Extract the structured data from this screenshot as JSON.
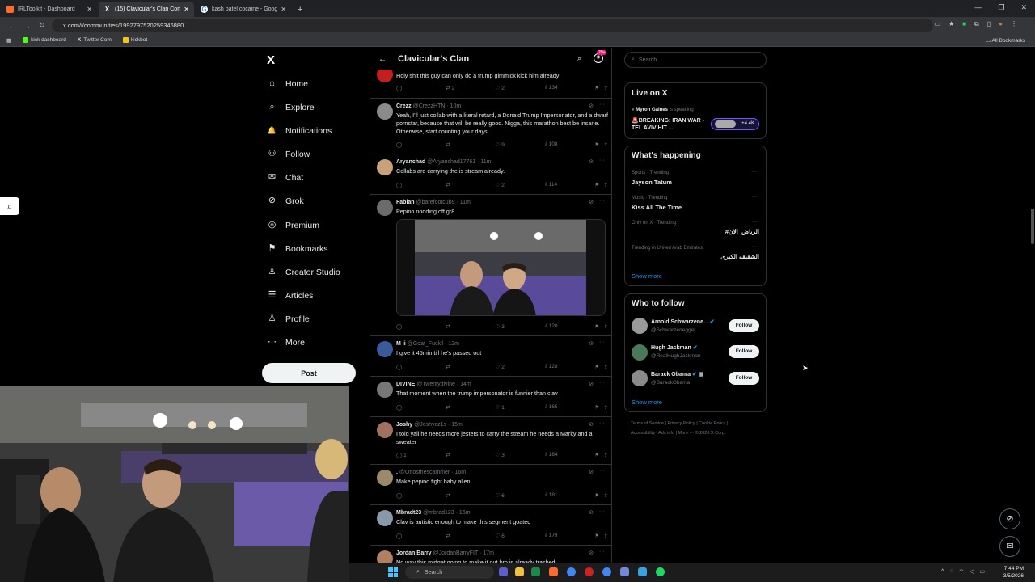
{
  "browser": {
    "tabs": [
      {
        "label": "IRLToolkit - Dashboard",
        "icon": "irltoolkit-icon",
        "color": "#ff6b2c",
        "active": false
      },
      {
        "label": "(15) Clavicular's Clan Commun...",
        "icon": "x-icon",
        "color": "#ffffff",
        "active": true
      },
      {
        "label": "kash patel cocaine - Google Se...",
        "icon": "google-icon",
        "color": "#4285f4",
        "active": false
      }
    ],
    "new_tab": "+",
    "url": "x.com/i/communities/1992797520259346880",
    "bookmarks": [
      {
        "label": "kick dashboard",
        "color": "#53fc18"
      },
      {
        "label": "Twitter Com",
        "color": "#ffffff"
      },
      {
        "label": "kickbot",
        "color": "#f5c518"
      }
    ],
    "all_bookmarks": "All Bookmarks"
  },
  "sidebar": {
    "logo": "X",
    "items": [
      {
        "label": "Home",
        "icon": "home-icon",
        "glyph": "⌂"
      },
      {
        "label": "Explore",
        "icon": "search-icon",
        "glyph": "⌕"
      },
      {
        "label": "Notifications",
        "icon": "bell-icon",
        "glyph": "🔔"
      },
      {
        "label": "Follow",
        "icon": "follow-icon",
        "glyph": "⚇"
      },
      {
        "label": "Chat",
        "icon": "mail-icon",
        "glyph": "✉"
      },
      {
        "label": "Grok",
        "icon": "grok-icon",
        "glyph": "⊘"
      },
      {
        "label": "Premium",
        "icon": "premium-icon",
        "glyph": "◎"
      },
      {
        "label": "Bookmarks",
        "icon": "bookmark-icon",
        "glyph": "⚑"
      },
      {
        "label": "Creator Studio",
        "icon": "creator-studio-icon",
        "glyph": "♙"
      },
      {
        "label": "Articles",
        "icon": "articles-icon",
        "glyph": "☰"
      },
      {
        "label": "Profile",
        "icon": "profile-icon",
        "glyph": "♙"
      },
      {
        "label": "More",
        "icon": "more-icon",
        "glyph": "⋯"
      }
    ],
    "post_button": "Post"
  },
  "feed": {
    "back": "←",
    "title": "Clavicular's Clan",
    "badge": "20+",
    "first_text": "Holy shit this guy can only do a trump gimmick kick him already",
    "first_actions": {
      "replies": "",
      "reposts": "2",
      "likes": "2",
      "views": "134"
    },
    "tweets": [
      {
        "name": "Crezz",
        "handle": "@CrezzHTN · 10m",
        "text": "Yeah, I'll just collab with a literal retard, a Donald Trump Impersonator, and a dwarf pornstar, because that will be really good. Nigga, this marathon best be insane. Otherwise, start counting your days.",
        "replies": "",
        "reposts": "",
        "likes": "9",
        "views": "108",
        "avatar": "#8a8a8a"
      },
      {
        "name": "Aryanchad",
        "handle": "@Aryanchad17761 · 11m",
        "text": "Collabs are carrying the is stream already.",
        "replies": "",
        "reposts": "",
        "likes": "2",
        "views": "114",
        "avatar": "#c9a27a"
      },
      {
        "name": "Fabian",
        "handle": "@barefootcub9 · 11m",
        "text": "Pepino nodding off gr8",
        "replies": "",
        "reposts": "",
        "likes": "3",
        "views": "120",
        "avatar": "#6b6b6b"
      },
      {
        "name": "M ii",
        "handle": "@Goat_Fuckll · 12m",
        "text": "I give it 45min till he's passed out",
        "replies": "",
        "reposts": "",
        "likes": "2",
        "views": "128",
        "avatar": "#3b5a9a"
      },
      {
        "name": "DIVINE",
        "handle": "@Twentydivine · 14m",
        "text": "That moment when the trump impersonator is funnier than clav",
        "replies": "",
        "reposts": "",
        "likes": "1",
        "views": "165",
        "avatar": "#777777"
      },
      {
        "name": "Joshy",
        "handle": "@Joshycz1s · 15m",
        "text": "I told yall he needs more jesters to carry the stream he needs a Marky and a sweater",
        "replies": "1",
        "reposts": "",
        "likes": "3",
        "views": "184",
        "avatar": "#a07060"
      },
      {
        "name": ".",
        "handle": "@Ottosthescammer · 16m",
        "text": "Make pepino fight baby alien",
        "replies": "",
        "reposts": "",
        "likes": "6",
        "views": "181",
        "avatar": "#9a8a6a"
      },
      {
        "name": "Mbradt23",
        "handle": "@mbrad123 · 16m",
        "text": "Clav is autistic enough to make this segment goated",
        "replies": "",
        "reposts": "",
        "likes": "6",
        "views": "179",
        "avatar": "#8899aa"
      },
      {
        "name": "Jordan Barry",
        "handle": "@JordanBarryFIT · 17m",
        "text": "No way this midget going to make it out bro is already trashed",
        "replies": "",
        "reposts": "",
        "likes": "",
        "views": "",
        "avatar": "#b08060"
      }
    ]
  },
  "right": {
    "search_placeholder": "Search",
    "live": {
      "title": "Live on X",
      "host": "Myron Gaines",
      "host_suffix": "is speaking",
      "headline": "🚨BREAKING: IRAN WAR - TEL AVIV HIT ...",
      "listeners": "+4.4K"
    },
    "happening": {
      "title": "What's happening",
      "trends": [
        {
          "context": "Sports · Trending",
          "topic": "Jayson Tatum"
        },
        {
          "context": "Music · Trending",
          "topic": "Kiss All The Time"
        },
        {
          "context": "Only on X · Trending",
          "topic": "#الرياض_الان"
        },
        {
          "context": "Trending in United Arab Emirates",
          "topic": "الشقيقه الكبرى"
        }
      ],
      "show_more": "Show more"
    },
    "who_to_follow": {
      "title": "Who to follow",
      "accounts": [
        {
          "name": "Arnold Schwarzene...",
          "handle": "@Schwarzenegger",
          "button": "Follow",
          "avatar": "#9a9a9a"
        },
        {
          "name": "Hugh Jackman",
          "handle": "@RealHughJackman",
          "button": "Follow",
          "avatar": "#4a7a5a"
        },
        {
          "name": "Barack Obama",
          "handle": "@BarackObama",
          "button": "Follow",
          "avatar": "#8a8a8a"
        }
      ],
      "show_more": "Show more"
    },
    "footer": {
      "line1": "Terms of Service  |  Privacy Policy  |  Cookie Policy  |",
      "line2": "Accessibility  |  Ads info  |  More ···  © 2026 X Corp."
    }
  },
  "taskbar": {
    "search": "Search",
    "time": "7:44 PM",
    "date": "3/5/2026"
  },
  "colors": {
    "accent": "#1d9bf0",
    "background": "#000000",
    "border": "#2f3336",
    "muted": "#71767b"
  }
}
